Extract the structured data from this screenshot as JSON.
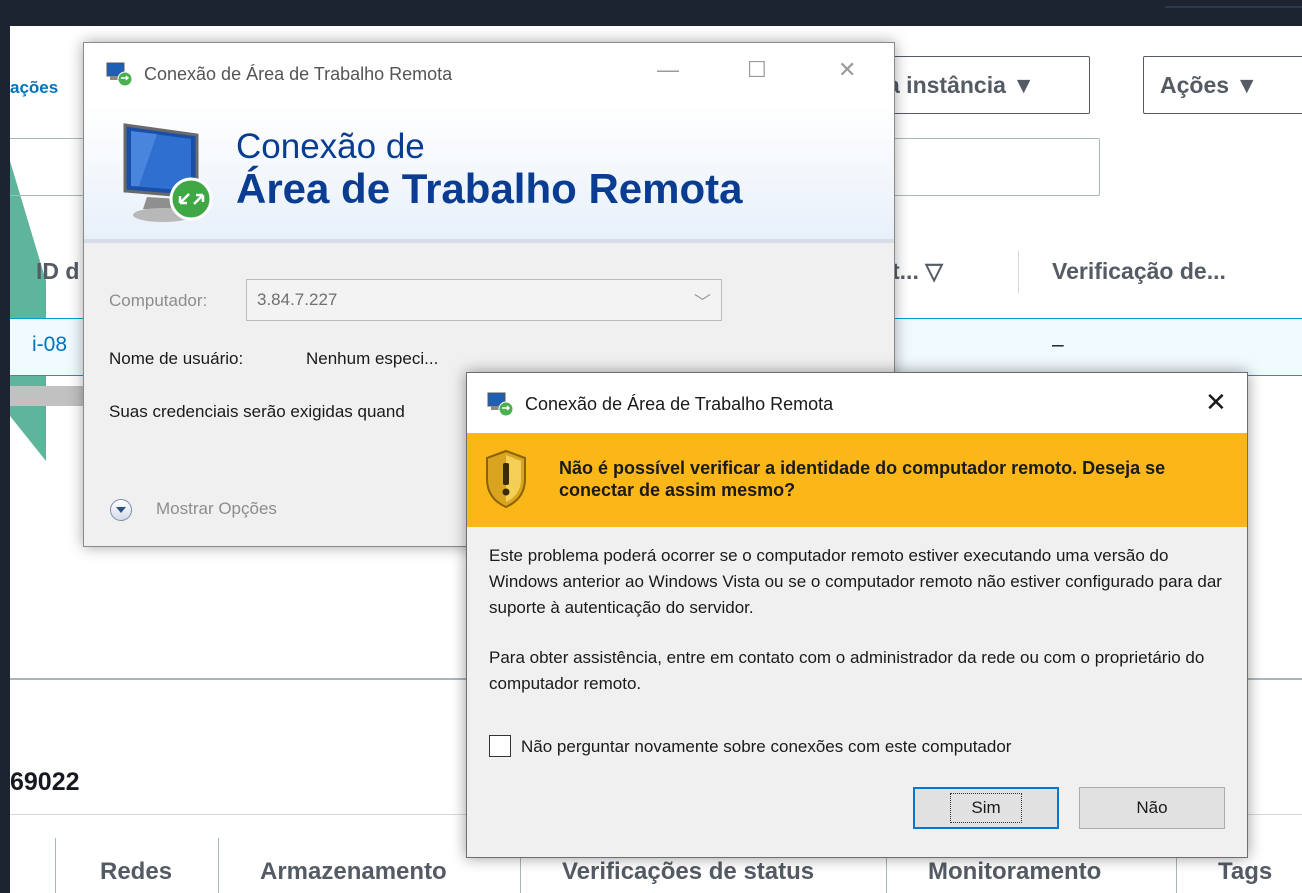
{
  "console": {
    "breadcrumb": "ações",
    "launch_button": "a instância ▼",
    "actions_button": "Ações ▼",
    "table": {
      "headers": [
        "ID d",
        "t... ▽",
        "Verificação de..."
      ],
      "row": {
        "id": "i-08",
        "check": "–"
      }
    },
    "instance_suffix": "69022",
    "tabs": [
      "Redes",
      "Armazenamento",
      "Verificações de status",
      "Monitoramento",
      "Tags"
    ]
  },
  "rdp_window": {
    "title": "Conexão de Área de Trabalho Remota",
    "banner_line1": "Conexão de",
    "banner_line2": "Área de Trabalho Remota",
    "computer_label": "Computador:",
    "computer_value": "3.84.7.227",
    "username_label": "Nome de usuário:",
    "username_value": "Nenhum especi...",
    "credentials_message": "Suas credenciais serão exigidas quand",
    "show_options": "Mostrar Opções",
    "controls": {
      "minimize": "—",
      "maximize": "☐",
      "close": "✕"
    }
  },
  "warning_dialog": {
    "title": "Conexão de Área de Trabalho Remota",
    "close": "✕",
    "heading": "Não é possível verificar a identidade do computador remoto. Deseja se conectar de assim mesmo?",
    "paragraph1": "Este problema poderá ocorrer se o computador remoto estiver executando uma versão do Windows anterior ao Windows Vista ou se o computador remoto não estiver configurado para dar suporte à autenticação do servidor.",
    "paragraph2": "Para obter assistência, entre em contato com o administrador da rede ou com o proprietário do computador remoto.",
    "checkbox_label": "Não perguntar novamente sobre conexões com este computador",
    "checkbox_checked": false,
    "yes_button": "Sim",
    "no_button": "Não"
  },
  "colors": {
    "warning_band": "#fbb717",
    "banner_text": "#0a3d91",
    "aws_link": "#0073bb",
    "background_dark": "#1c2431"
  }
}
